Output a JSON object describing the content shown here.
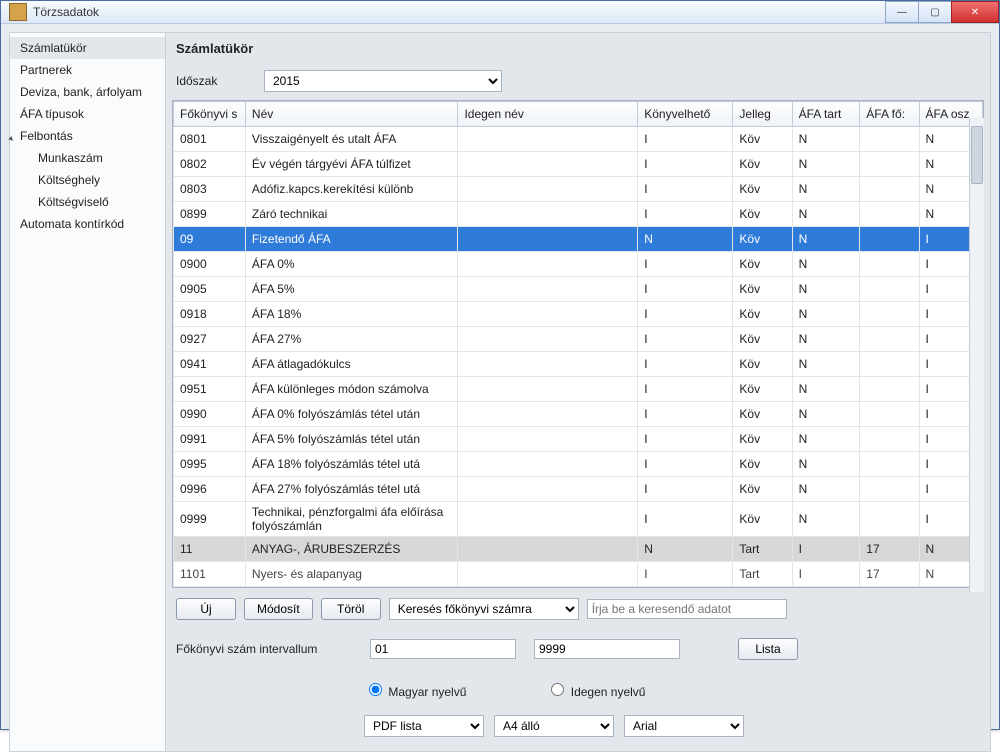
{
  "window": {
    "title": "Törzsadatok"
  },
  "sidebar": {
    "items": [
      {
        "label": "Számlatükör",
        "selected": true
      },
      {
        "label": "Partnerek"
      },
      {
        "label": "Deviza, bank, árfolyam"
      },
      {
        "label": "ÁFA típusok"
      },
      {
        "label": "Felbontás",
        "expandable": true
      },
      {
        "label": "Munkaszám",
        "sub": true
      },
      {
        "label": "Költséghely",
        "sub": true
      },
      {
        "label": "Költségviselő",
        "sub": true
      },
      {
        "label": "Automata kontírkód"
      }
    ]
  },
  "page": {
    "title": "Számlatükör",
    "period_label": "Időszak",
    "period_value": "2015"
  },
  "grid": {
    "columns": [
      "Főkönyvi s",
      "Név",
      "Idegen név",
      "Könyvelhető",
      "Jelleg",
      "ÁFA tart",
      "ÁFA fő:",
      "ÁFA osz"
    ],
    "rows": [
      {
        "c": [
          "0801",
          "Visszaigényelt és utalt ÁFA",
          "",
          "I",
          "Köv",
          "N",
          "",
          "N"
        ]
      },
      {
        "c": [
          "0802",
          "Év végén tárgyévi ÁFA túlfizet",
          "",
          "I",
          "Köv",
          "N",
          "",
          "N"
        ]
      },
      {
        "c": [
          "0803",
          "Adófiz.kapcs.kerekítési különb",
          "",
          "I",
          "Köv",
          "N",
          "",
          "N"
        ]
      },
      {
        "c": [
          "0899",
          "Záró technikai",
          "",
          "I",
          "Köv",
          "N",
          "",
          "N"
        ]
      },
      {
        "c": [
          "09",
          "Fizetendő ÁFA",
          "",
          "N",
          "Köv",
          "N",
          "",
          "I"
        ],
        "selected": true
      },
      {
        "c": [
          "0900",
          "ÁFA 0%",
          "",
          "I",
          "Köv",
          "N",
          "",
          "I"
        ]
      },
      {
        "c": [
          "0905",
          "ÁFA 5%",
          "",
          "I",
          "Köv",
          "N",
          "",
          "I"
        ]
      },
      {
        "c": [
          "0918",
          "ÁFA 18%",
          "",
          "I",
          "Köv",
          "N",
          "",
          "I"
        ]
      },
      {
        "c": [
          "0927",
          "ÁFA 27%",
          "",
          "I",
          "Köv",
          "N",
          "",
          "I"
        ]
      },
      {
        "c": [
          "0941",
          "ÁFA átlagadókulcs",
          "",
          "I",
          "Köv",
          "N",
          "",
          "I"
        ]
      },
      {
        "c": [
          "0951",
          "ÁFA különleges módon számolva",
          "",
          "I",
          "Köv",
          "N",
          "",
          "I"
        ]
      },
      {
        "c": [
          "0990",
          "ÁFA 0% folyószámlás tétel után",
          "",
          "I",
          "Köv",
          "N",
          "",
          "I"
        ]
      },
      {
        "c": [
          "0991",
          "ÁFA 5% folyószámlás tétel után",
          "",
          "I",
          "Köv",
          "N",
          "",
          "I"
        ]
      },
      {
        "c": [
          "0995",
          "ÁFA 18% folyószámlás tétel utá",
          "",
          "I",
          "Köv",
          "N",
          "",
          "I"
        ]
      },
      {
        "c": [
          "0996",
          "ÁFA 27% folyószámlás tétel utá",
          "",
          "I",
          "Köv",
          "N",
          "",
          "I"
        ]
      },
      {
        "c": [
          "0999",
          "Technikai, pénzforgalmi áfa előírása folyószámlán",
          "",
          "I",
          "Köv",
          "N",
          "",
          "I"
        ],
        "wrap": true
      },
      {
        "c": [
          "11",
          "ANYAG-, ÁRUBESZERZÉS",
          "",
          "N",
          "Tart",
          "I",
          "17",
          "N"
        ],
        "group": true
      },
      {
        "c": [
          "1101",
          "Nyers- és alapanyag",
          "",
          "I",
          "Tart",
          "I",
          "17",
          "N"
        ],
        "clip": true
      }
    ]
  },
  "toolbar": {
    "new_label": "Új",
    "edit_label": "Módosít",
    "delete_label": "Töröl",
    "search_mode": "Keresés főkönyvi számra",
    "search_placeholder": "Írja be a keresendő adatot"
  },
  "interval": {
    "label": "Főkönyvi szám intervallum",
    "from": "01",
    "to": "9999",
    "list_label": "Lista"
  },
  "lang": {
    "hu": "Magyar nyelvű",
    "for": "Idegen nyelvű"
  },
  "list_opts": {
    "format": "PDF lista",
    "orientation": "A4 álló",
    "font": "Arial"
  }
}
